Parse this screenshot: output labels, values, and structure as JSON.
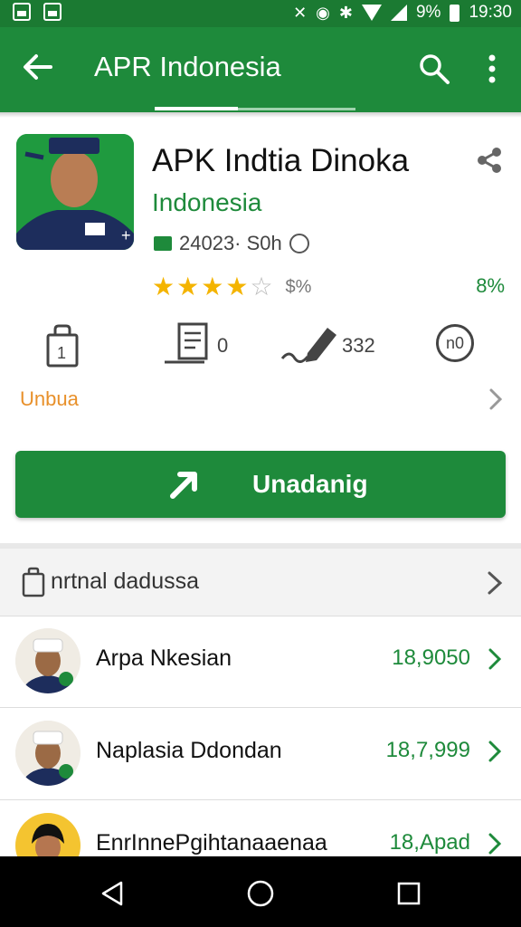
{
  "status_bar": {
    "battery_text": "9%",
    "time": "19:30"
  },
  "app_bar": {
    "title": "APR Indonesia"
  },
  "app": {
    "title": "APK Indtia  Dinoka",
    "developer": "Indonesia",
    "meta": "24023· S0h",
    "rating_text": "$%",
    "rating_stars": 4.5,
    "right_percent": "8%",
    "stats": [
      {
        "label": "1"
      },
      {
        "label": "0"
      },
      {
        "label": "332"
      },
      {
        "label": "n0"
      }
    ],
    "category": "Unbua"
  },
  "install_button": {
    "label": "Unadanig"
  },
  "section": {
    "title": "nrtnal dadussa"
  },
  "list": [
    {
      "name": "Arpa Nkesian",
      "value": "18,9050"
    },
    {
      "name": "Naplasia Ddondan",
      "value": "18,7,999"
    },
    {
      "name": "EnrInnePgihtanaaenaa",
      "value": "18,Apad"
    }
  ],
  "colors": {
    "primary": "#1e8a3b",
    "status_bar": "#1b7a32",
    "accent_orange": "#e8902a",
    "star": "#f4b400"
  },
  "icons": {
    "back": "arrow-back-icon",
    "search": "search-icon",
    "more": "more-vert-icon",
    "share": "share-icon",
    "install": "arrow-icon"
  }
}
